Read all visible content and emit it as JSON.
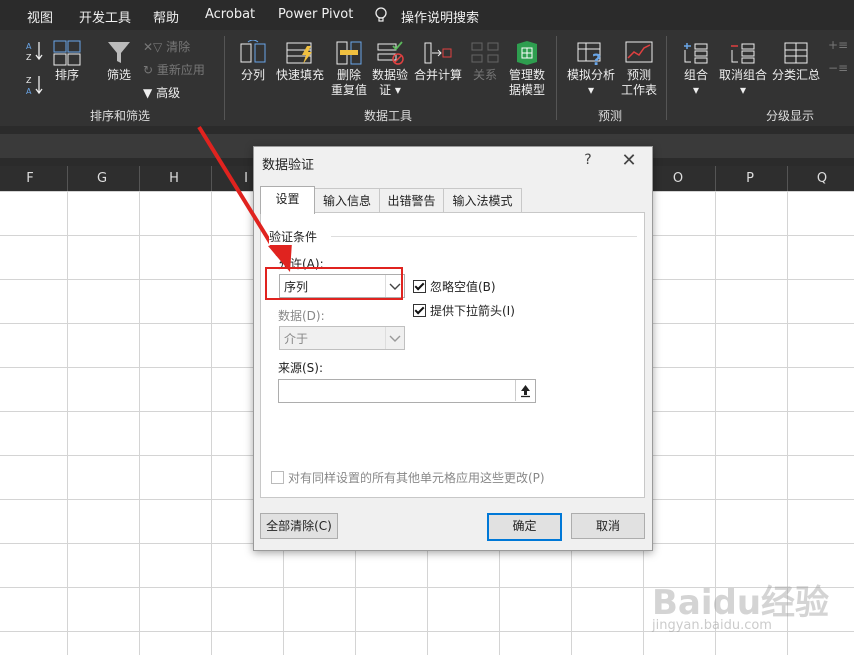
{
  "menubar": {
    "items": [
      "视图",
      "开发工具",
      "帮助",
      "Acrobat",
      "Power Pivot",
      "操作说明搜索"
    ]
  },
  "ribbon": {
    "sort_filter": {
      "sort": "排序",
      "filter": "筛选",
      "clear": "清除",
      "reapply": "重新应用",
      "advanced": "高级",
      "label": "排序和筛选"
    },
    "data_tools": {
      "split": "分列",
      "flash_fill": "快速填充",
      "remove_dup_1": "删除",
      "remove_dup_2": "重复值",
      "validation_1": "数据验",
      "validation_2": "证",
      "consolidate": "合并计算",
      "relations": "关系",
      "model_1": "管理数",
      "model_2": "据模型",
      "label": "数据工具"
    },
    "forecast": {
      "whatif": "模拟分析",
      "sheet_1": "预测",
      "sheet_2": "工作表",
      "label": "预测"
    },
    "outline": {
      "group": "组合",
      "ungroup": "取消组合",
      "subtotal": "分类汇总",
      "label": "分级显示"
    }
  },
  "columns": [
    "F",
    "G",
    "H",
    "I",
    "O",
    "P",
    "Q"
  ],
  "dialog": {
    "title": "数据验证",
    "help": "?",
    "close": "✕",
    "tabs": [
      "设置",
      "输入信息",
      "出错警告",
      "输入法模式"
    ],
    "criteria_legend": "验证条件",
    "allow_label": "允许(A):",
    "allow_value": "序列",
    "data_label": "数据(D):",
    "data_value": "介于",
    "ignore_blank": "忽略空值(B)",
    "dropdown": "提供下拉箭头(I)",
    "source_label": "来源(S):",
    "source_value": "",
    "apply_all": "对有同样设置的所有其他单元格应用这些更改(P)",
    "clear_all": "全部清除(C)",
    "ok": "确定",
    "cancel": "取消"
  },
  "watermark": {
    "brand": "Baidu经验",
    "url": "jingyan.baidu.com"
  },
  "colors": {
    "annotation": "#e0231f",
    "ok_border": "#0078d7"
  }
}
